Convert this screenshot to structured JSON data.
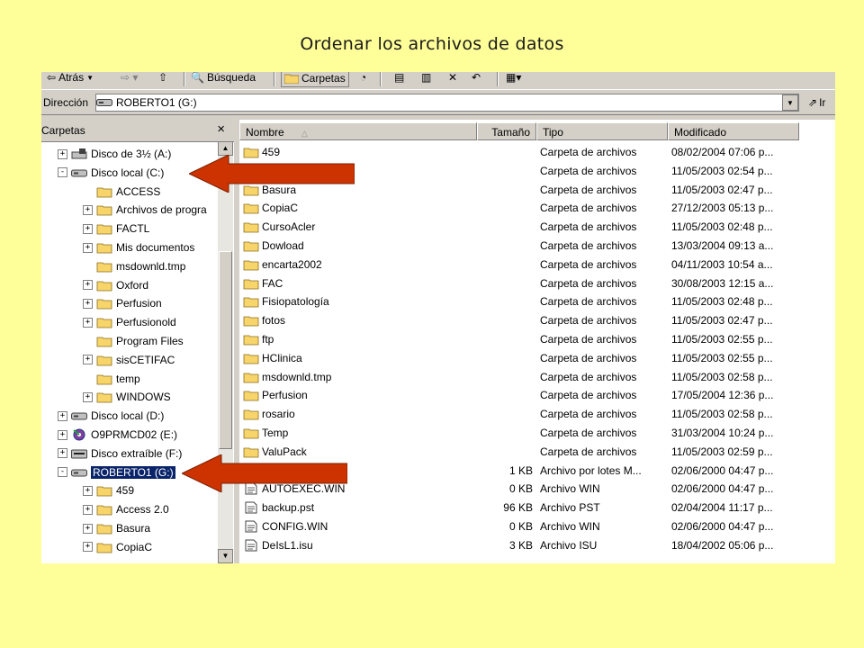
{
  "slide": {
    "title": "Ordenar los archivos de datos"
  },
  "toolbar": {
    "back": "Atrás",
    "search": "Búsqueda",
    "folders": "Carpetas"
  },
  "address": {
    "label": "Dirección",
    "value": "ROBERTO1 (G:)",
    "go": "Ir"
  },
  "folders_pane": {
    "title": "Carpetas",
    "close": "×",
    "items": [
      {
        "label": "Disco de 3½ (A:)",
        "icon": "floppy-drive-icon",
        "exp": "+"
      },
      {
        "label": "Disco local (C:)",
        "icon": "hard-drive-icon",
        "exp": "-"
      },
      {
        "label": "ACCESS",
        "icon": "folder-icon",
        "exp": ""
      },
      {
        "label": "Archivos de progra",
        "icon": "folder-icon",
        "exp": "+"
      },
      {
        "label": "FACTL",
        "icon": "folder-icon",
        "exp": "+"
      },
      {
        "label": "Mis documentos",
        "icon": "folder-icon",
        "exp": "+"
      },
      {
        "label": "msdownld.tmp",
        "icon": "folder-icon",
        "exp": ""
      },
      {
        "label": "Oxford",
        "icon": "folder-icon",
        "exp": "+"
      },
      {
        "label": "Perfusion",
        "icon": "folder-icon",
        "exp": "+"
      },
      {
        "label": "Perfusionold",
        "icon": "folder-icon",
        "exp": "+"
      },
      {
        "label": "Program Files",
        "icon": "folder-icon",
        "exp": ""
      },
      {
        "label": "sisCETIFAC",
        "icon": "folder-icon",
        "exp": "+"
      },
      {
        "label": "temp",
        "icon": "folder-icon",
        "exp": ""
      },
      {
        "label": "WINDOWS",
        "icon": "folder-icon",
        "exp": "+"
      },
      {
        "label": "Disco local (D:)",
        "icon": "hard-drive-icon",
        "exp": "+"
      },
      {
        "label": "O9PRMCD02 (E:)",
        "icon": "cd-drive-icon",
        "exp": "+"
      },
      {
        "label": "Disco extraíble (F:)",
        "icon": "removable-drive-icon",
        "exp": "+"
      },
      {
        "label": "ROBERTO1 (G:)",
        "icon": "hard-drive-icon",
        "exp": "-",
        "selected": true
      },
      {
        "label": "459",
        "icon": "folder-icon",
        "exp": "+"
      },
      {
        "label": "Access 2.0",
        "icon": "folder-icon",
        "exp": "+"
      },
      {
        "label": "Basura",
        "icon": "folder-icon",
        "exp": "+"
      },
      {
        "label": "CopiaC",
        "icon": "folder-icon",
        "exp": "+"
      }
    ]
  },
  "file_list": {
    "columns": [
      "Nombre",
      "Tamaño",
      "Tipo",
      "Modificado"
    ],
    "rows": [
      {
        "name": "459",
        "size": "",
        "type": "Carpeta de archivos",
        "modified": "08/02/2004 07:06 p...",
        "icon": "folder-icon"
      },
      {
        "name": "",
        "size": "",
        "type": "Carpeta de archivos",
        "modified": "11/05/2003 02:54 p...",
        "icon": "folder-icon"
      },
      {
        "name": "Basura",
        "size": "",
        "type": "Carpeta de archivos",
        "modified": "11/05/2003 02:47 p...",
        "icon": "folder-icon"
      },
      {
        "name": "CopiaC",
        "size": "",
        "type": "Carpeta de archivos",
        "modified": "27/12/2003 05:13 p...",
        "icon": "folder-icon"
      },
      {
        "name": "CursoAcler",
        "size": "",
        "type": "Carpeta de archivos",
        "modified": "11/05/2003 02:48 p...",
        "icon": "folder-icon"
      },
      {
        "name": "Dowload",
        "size": "",
        "type": "Carpeta de archivos",
        "modified": "13/03/2004 09:13 a...",
        "icon": "folder-icon"
      },
      {
        "name": "encarta2002",
        "size": "",
        "type": "Carpeta de archivos",
        "modified": "04/11/2003 10:54 a...",
        "icon": "folder-icon"
      },
      {
        "name": "FAC",
        "size": "",
        "type": "Carpeta de archivos",
        "modified": "30/08/2003 12:15 a...",
        "icon": "folder-icon"
      },
      {
        "name": "Fisiopatología",
        "size": "",
        "type": "Carpeta de archivos",
        "modified": "11/05/2003 02:48 p...",
        "icon": "folder-icon"
      },
      {
        "name": "fotos",
        "size": "",
        "type": "Carpeta de archivos",
        "modified": "11/05/2003 02:47 p...",
        "icon": "folder-icon"
      },
      {
        "name": "ftp",
        "size": "",
        "type": "Carpeta de archivos",
        "modified": "11/05/2003 02:55 p...",
        "icon": "folder-icon"
      },
      {
        "name": "HClinica",
        "size": "",
        "type": "Carpeta de archivos",
        "modified": "11/05/2003 02:55 p...",
        "icon": "folder-icon"
      },
      {
        "name": "msdownld.tmp",
        "size": "",
        "type": "Carpeta de archivos",
        "modified": "11/05/2003 02:58 p...",
        "icon": "folder-icon"
      },
      {
        "name": "Perfusion",
        "size": "",
        "type": "Carpeta de archivos",
        "modified": "17/05/2004 12:36 p...",
        "icon": "folder-icon"
      },
      {
        "name": "rosario",
        "size": "",
        "type": "Carpeta de archivos",
        "modified": "11/05/2003 02:58 p...",
        "icon": "folder-icon"
      },
      {
        "name": "Temp",
        "size": "",
        "type": "Carpeta de archivos",
        "modified": "31/03/2004 10:24 p...",
        "icon": "folder-icon"
      },
      {
        "name": "ValuPack",
        "size": "",
        "type": "Carpeta de archivos",
        "modified": "11/05/2003 02:59 p...",
        "icon": "folder-icon"
      },
      {
        "name": "",
        "size": "1 KB",
        "type": "Archivo por lotes M...",
        "modified": "02/06/2000 04:47 p...",
        "icon": "batch-file-icon"
      },
      {
        "name": "AUTOEXEC.WIN",
        "size": "0 KB",
        "type": "Archivo WIN",
        "modified": "02/06/2000 04:47 p...",
        "icon": "file-icon"
      },
      {
        "name": "backup.pst",
        "size": "96 KB",
        "type": "Archivo PST",
        "modified": "02/04/2004 11:17 p...",
        "icon": "file-icon"
      },
      {
        "name": "CONFIG.WIN",
        "size": "0 KB",
        "type": "Archivo WIN",
        "modified": "02/06/2000 04:47 p...",
        "icon": "file-icon"
      },
      {
        "name": "DeIsL1.isu",
        "size": "3 KB",
        "type": "Archivo ISU",
        "modified": "18/04/2002 05:06 p...",
        "icon": "file-icon"
      }
    ]
  },
  "colors": {
    "background": "#ffff99",
    "arrow": "#cc3300",
    "selection": "#0a246a",
    "chrome": "#d4d0c8"
  }
}
